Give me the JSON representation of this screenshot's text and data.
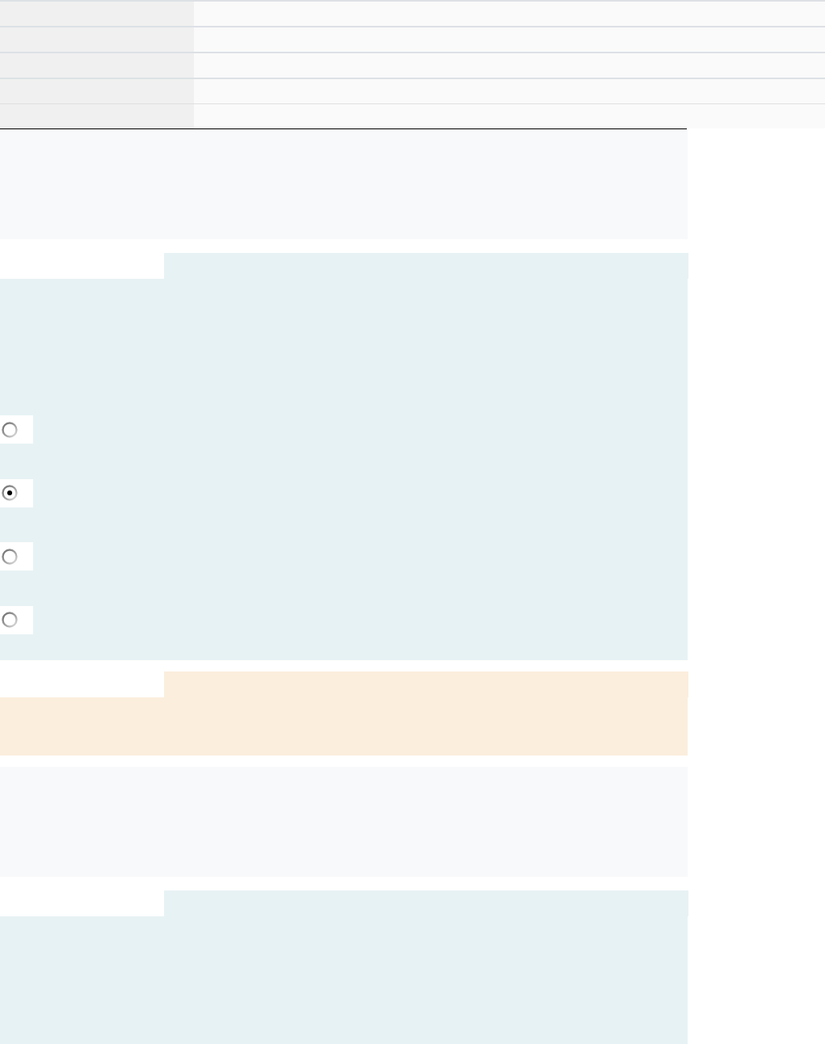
{
  "table": {
    "rows": [
      {},
      {},
      {},
      {},
      {}
    ]
  },
  "sections": [
    {
      "kind": "plain"
    },
    {
      "kind": "tabbed",
      "color": "#e7f2f4",
      "options": [
        {
          "selected": false
        },
        {
          "selected": true
        },
        {
          "selected": false
        },
        {
          "selected": false
        }
      ]
    },
    {
      "kind": "tabbed",
      "color": "#fbeedd"
    },
    {
      "kind": "plain"
    },
    {
      "kind": "tabbed",
      "color": "#e7f2f4"
    }
  ]
}
